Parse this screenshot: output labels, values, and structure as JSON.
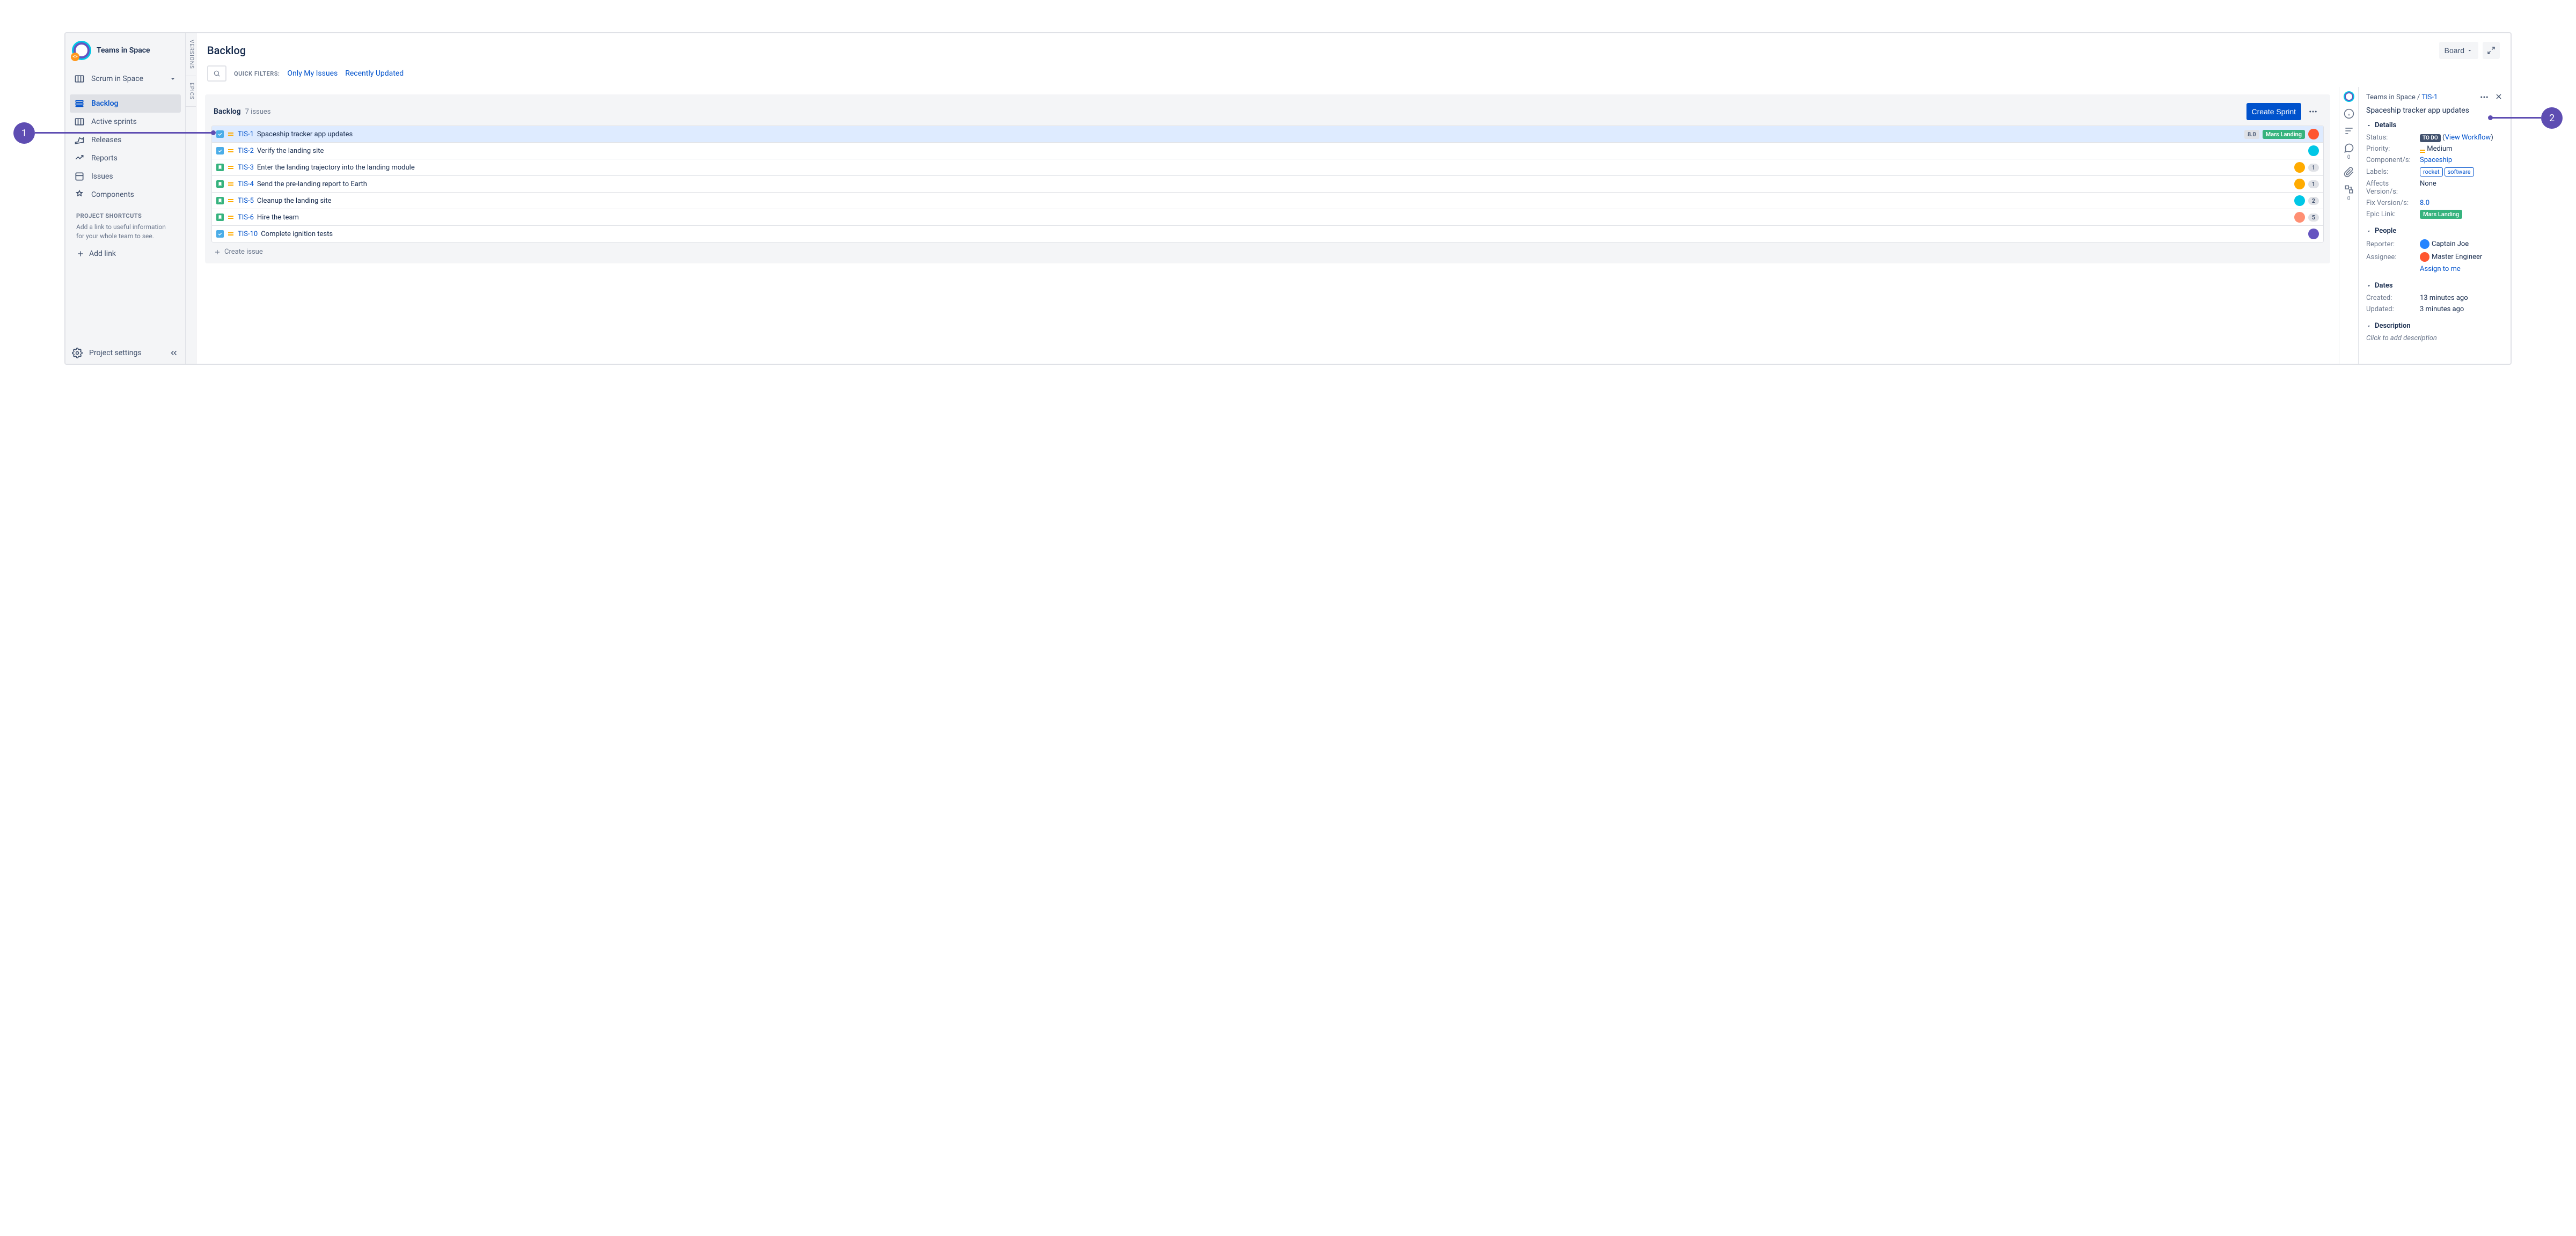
{
  "project_name": "Teams in Space",
  "board_name": "Scrum in Space",
  "sidebar_items": [
    {
      "label": "Backlog",
      "active": true
    },
    {
      "label": "Active sprints",
      "active": false
    },
    {
      "label": "Releases",
      "active": false
    },
    {
      "label": "Reports",
      "active": false
    },
    {
      "label": "Issues",
      "active": false
    },
    {
      "label": "Components",
      "active": false
    }
  ],
  "shortcuts_heading": "PROJECT SHORTCUTS",
  "shortcuts_desc": "Add a link to useful information for your whole team to see.",
  "add_link_label": "Add link",
  "project_settings_label": "Project settings",
  "vtabs": [
    "VERSIONS",
    "EPICS"
  ],
  "page_title": "Backlog",
  "board_button": "Board",
  "quick_filters_label": "QUICK FILTERS:",
  "quick_filters": [
    "Only My Issues",
    "Recently Updated"
  ],
  "backlog_section_title": "Backlog",
  "backlog_count": "7 issues",
  "create_sprint_label": "Create Sprint",
  "create_issue_label": "Create issue",
  "issues": [
    {
      "key": "TIS-1",
      "summary": "Spaceship tracker app updates",
      "type": "task",
      "version": "8.0",
      "epic": "Mars Landing",
      "avatar": "orange",
      "selected": true
    },
    {
      "key": "TIS-2",
      "summary": "Verify the landing site",
      "type": "task",
      "avatar": "teal"
    },
    {
      "key": "TIS-3",
      "summary": "Enter the landing trajectory into the landing module",
      "type": "story",
      "avatar": "yellow",
      "count": "1"
    },
    {
      "key": "TIS-4",
      "summary": "Send the pre-landing report to Earth",
      "type": "story",
      "avatar": "yellow",
      "count": "1"
    },
    {
      "key": "TIS-5",
      "summary": "Cleanup the landing site",
      "type": "story",
      "avatar": "teal",
      "count": "2"
    },
    {
      "key": "TIS-6",
      "summary": "Hire the team",
      "type": "story",
      "avatar": "pink",
      "count": "5"
    },
    {
      "key": "TIS-10",
      "summary": "Complete ignition tests",
      "type": "task",
      "avatar": "purple"
    }
  ],
  "detail_comment_counts": {
    "comments": "0",
    "subtasks": "0"
  },
  "detail_breadcrumb_project": "Teams in Space",
  "detail_breadcrumb_key": "TIS-1",
  "detail_title": "Spaceship tracker app updates",
  "sections": {
    "details": "Details",
    "people": "People",
    "dates": "Dates",
    "description": "Description"
  },
  "detail_fields": {
    "status_label": "Status:",
    "status_value": "TO DO",
    "view_workflow": "View Workflow",
    "priority_label": "Priority:",
    "priority_value": "Medium",
    "components_label": "Component/s:",
    "components_value": "Spaceship",
    "labels_label": "Labels:",
    "labels": [
      "rocket",
      "software"
    ],
    "affects_label": "Affects Version/s:",
    "affects_value": "None",
    "fix_label": "Fix Version/s:",
    "fix_value": "8.0",
    "epic_label": "Epic Link:",
    "epic_value": "Mars Landing"
  },
  "people_fields": {
    "reporter_label": "Reporter:",
    "reporter_value": "Captain Joe",
    "assignee_label": "Assignee:",
    "assignee_value": "Master Engineer",
    "assign_to_me": "Assign to me"
  },
  "dates_fields": {
    "created_label": "Created:",
    "created_value": "13 minutes ago",
    "updated_label": "Updated:",
    "updated_value": "3 minutes ago"
  },
  "description_placeholder": "Click to add description",
  "annotations": {
    "one": "1",
    "two": "2"
  }
}
